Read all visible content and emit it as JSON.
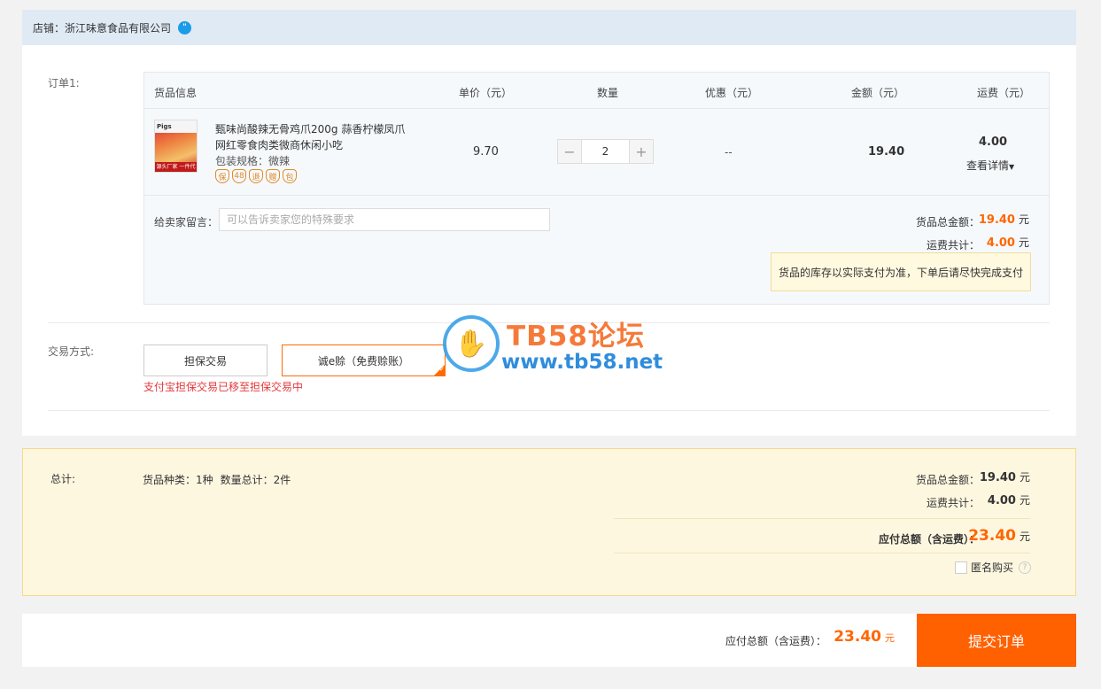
{
  "shop": {
    "label": "店铺：",
    "name": "浙江味意食品有限公司",
    "chat_icon": "chat-bubble-icon"
  },
  "order": {
    "label": "订单1:",
    "columns": [
      "货品信息",
      "单价（元）",
      "数量",
      "优惠（元）",
      "金额（元）",
      "运费（元）"
    ],
    "item": {
      "thumb_brand": "Pigs",
      "thumb_caption": "源头厂家 一件代发",
      "title": "甄味尚酸辣无骨鸡爪200g 蒜香柠檬凤爪网红零食肉类微商休闲小吃",
      "spec": "包装规格：微辣",
      "badges": [
        "保",
        "48",
        "退",
        "赠",
        "包"
      ],
      "unit_price": "9.70",
      "quantity": "2",
      "discount": "--",
      "amount": "19.40",
      "freight": "4.00",
      "freight_detail": "查看详情",
      "minus": "−",
      "plus": "+"
    },
    "message_label": "给卖家留言：",
    "message_placeholder": "可以告诉卖家您的特殊要求",
    "goods_total_label": "货品总金额：",
    "goods_total": "19.40",
    "freight_total_label": "运费共计：",
    "freight_total": "4.00",
    "unit": "元",
    "notice": "货品的库存以实际支付为准，下单后请尽快完成支付"
  },
  "payment": {
    "label": "交易方式:",
    "option_a": "担保交易",
    "option_b": "诚e赊（免费赊账）",
    "warning": "支付宝担保交易已移至担保交易中"
  },
  "watermark": {
    "title": "TB58论坛",
    "url": "www.tb58.net"
  },
  "total": {
    "label": "总计:",
    "kinds": "货品种类：1种",
    "count": "数量总计：2件",
    "goods_label": "货品总金额：",
    "goods": "19.40",
    "freight_label": "运费共计：",
    "freight": "4.00",
    "grand_label": "应付总额（含运费）：",
    "grand": "23.40",
    "unit": "元",
    "anonymous": "匿名购买",
    "help": "?"
  },
  "footer": {
    "label": "应付总额（含运费）：",
    "amount": "23.40",
    "unit": "元",
    "submit": "提交订单"
  }
}
